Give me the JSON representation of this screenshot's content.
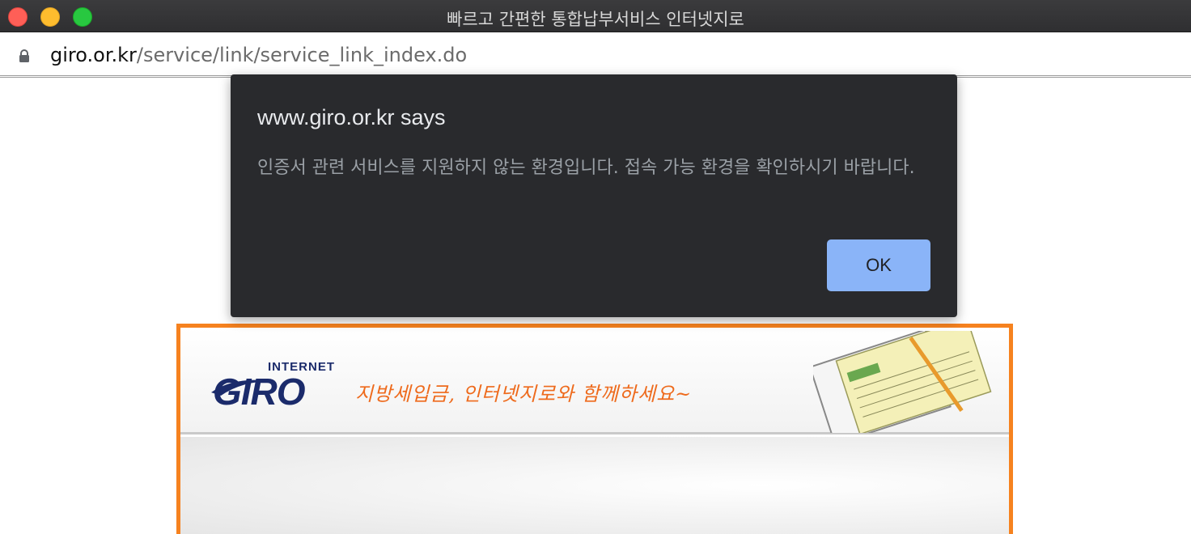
{
  "window": {
    "title": "빠르고 간편한 통합납부서비스 인터넷지로"
  },
  "address_bar": {
    "domain": "giro.or.kr",
    "path": "/service/link/service_link_index.do",
    "icon": "lock-icon"
  },
  "dialog": {
    "title": "www.giro.or.kr says",
    "message": "인증서 관련 서비스를 지원하지 않는 환경입니다. 접속 가능 환경을 확인하시기 바랍니다.",
    "ok_label": "OK",
    "button_color": "#8ab4f8"
  },
  "page": {
    "logo_top": "INTERNET",
    "logo_main": "GIRO",
    "slogan": "지방세입금, 인터넷지로와 함께하세요~",
    "accent_color": "#f6821f"
  }
}
